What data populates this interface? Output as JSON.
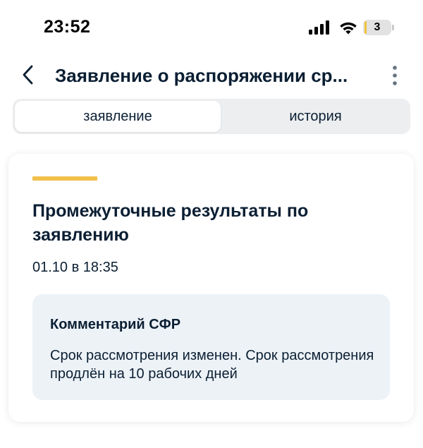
{
  "status_bar": {
    "time": "23:52",
    "battery_level": "3"
  },
  "header": {
    "title": "Заявление о распоряжении ср..."
  },
  "tabs": [
    {
      "label": "заявление",
      "active": true
    },
    {
      "label": "история",
      "active": false
    }
  ],
  "card": {
    "title": "Промежуточные результаты по заявлению",
    "date": "01.10 в 18:35",
    "comment": {
      "heading": "Комментарий СФР",
      "text": "Срок рассмотрения изменен. Срок рассмотрения продлён на 10 рабочих дней"
    }
  },
  "colors": {
    "accent": "#f2c04a",
    "text": "#0b1f33",
    "tab_bg": "#eceef0",
    "comment_bg": "#edf2f7"
  },
  "icons": {
    "back": "chevron-left-icon",
    "more": "more-vertical-icon",
    "signal": "cellular-signal-icon",
    "wifi": "wifi-icon",
    "battery": "battery-icon"
  }
}
